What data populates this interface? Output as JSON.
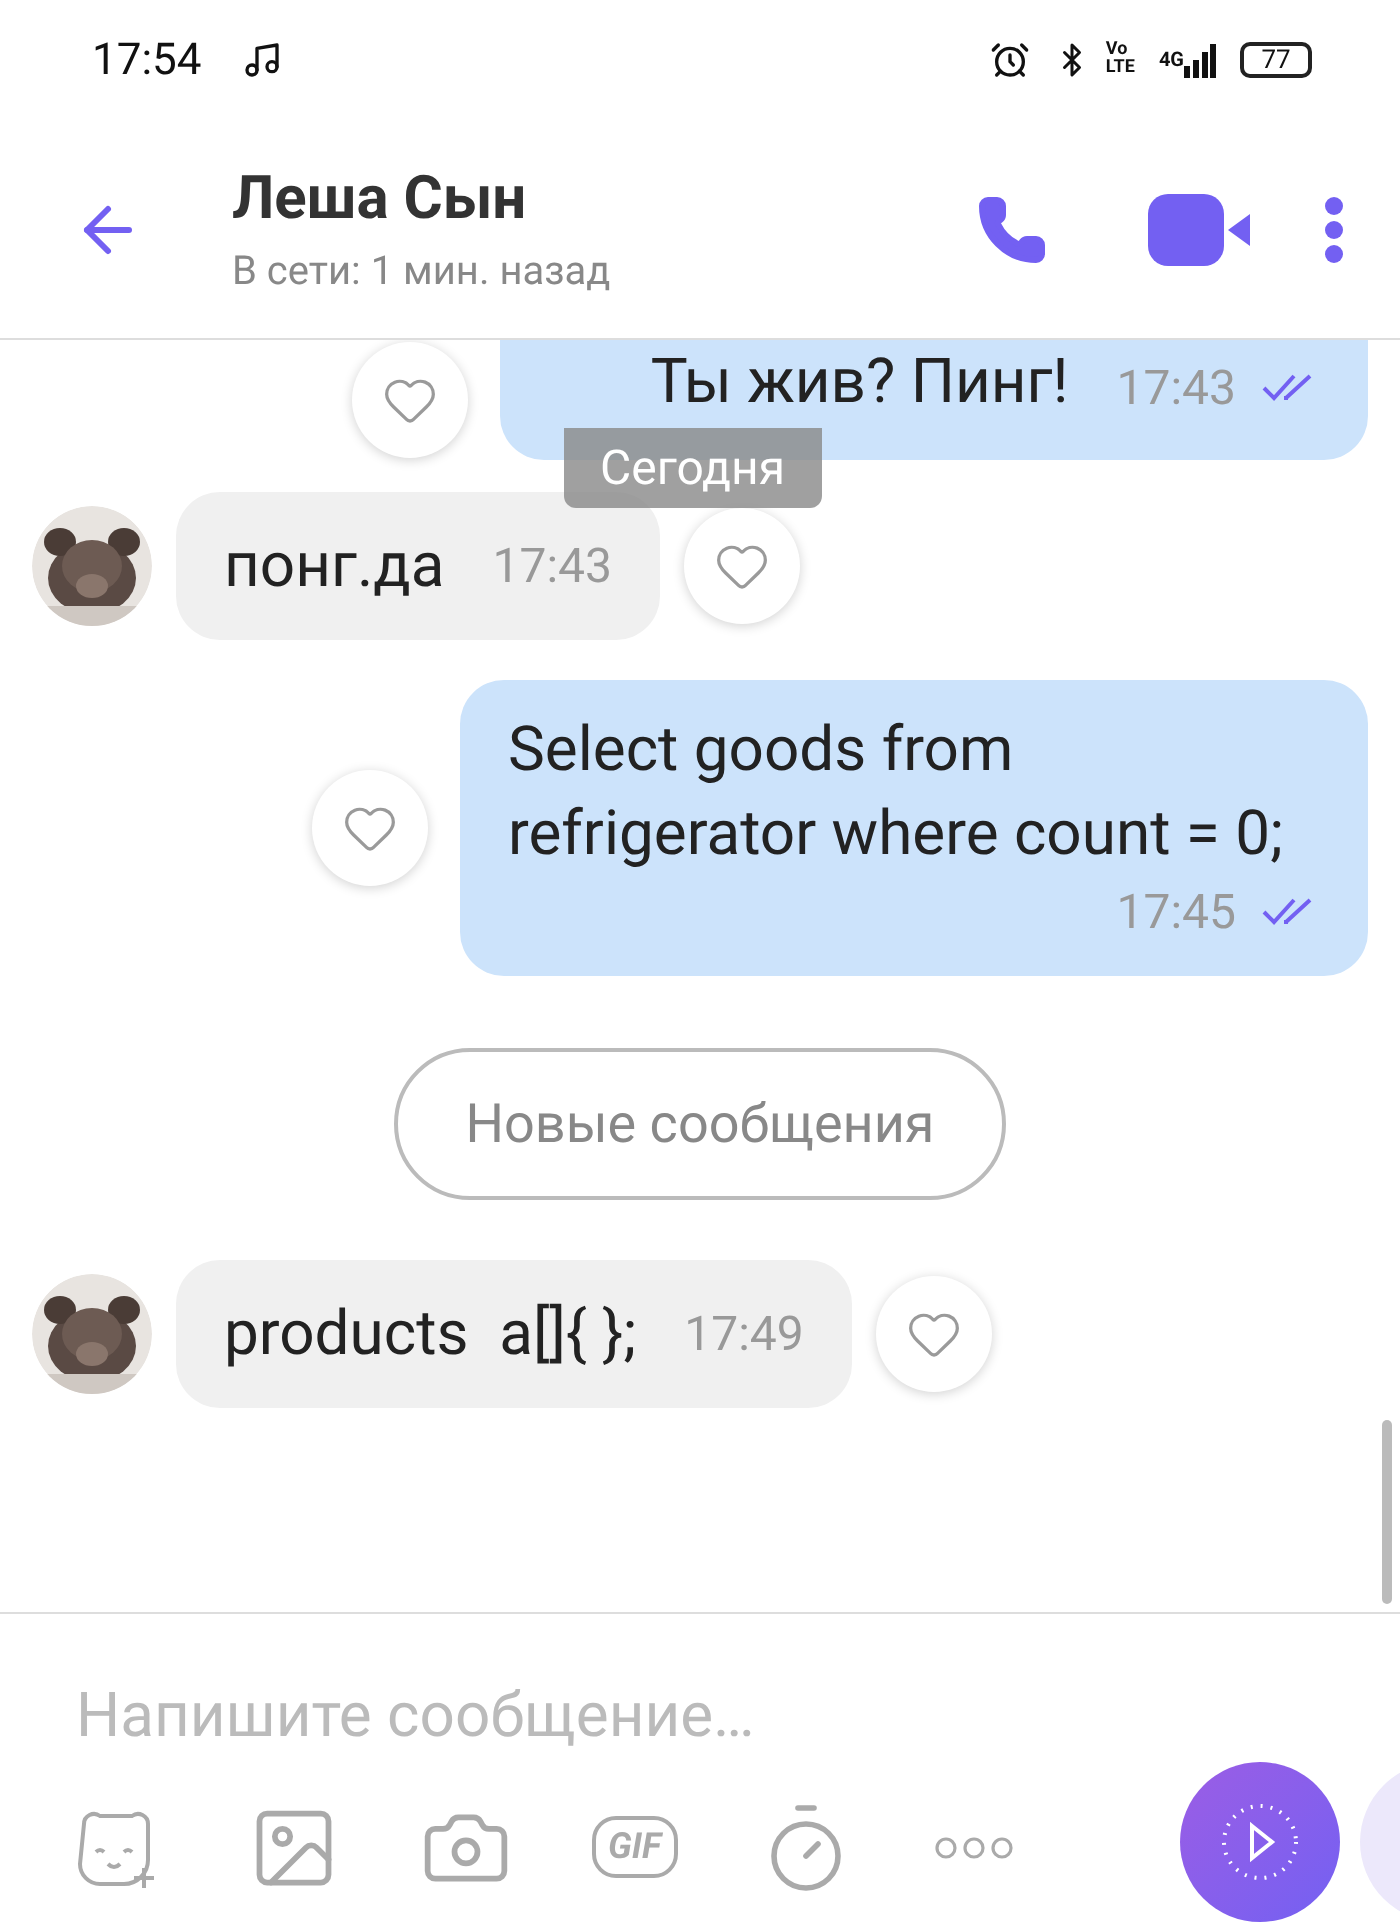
{
  "status_bar": {
    "time": "17:54",
    "volte_top": "Vo",
    "volte_bottom": "LTE",
    "network": "4G",
    "battery": "77"
  },
  "header": {
    "name": "Леша Сын",
    "status": "В сети: 1 мин. назад"
  },
  "date_chip": "Сегодня",
  "messages": [
    {
      "kind": "outgoing",
      "text": "Ты жив? Пинг!",
      "time": "17:43",
      "read": true
    },
    {
      "kind": "incoming",
      "text": "понг.да",
      "time": "17:43"
    },
    {
      "kind": "outgoing",
      "text": "Select goods from refrigerator where count = 0;",
      "time": "17:45",
      "read": true
    },
    {
      "kind": "divider",
      "text": "Новые сообщения"
    },
    {
      "kind": "incoming",
      "text": "products  a[]{ };",
      "time": "17:49"
    }
  ],
  "composer": {
    "placeholder": "Напишите сообщение…",
    "toolbar": [
      "GIF"
    ]
  }
}
